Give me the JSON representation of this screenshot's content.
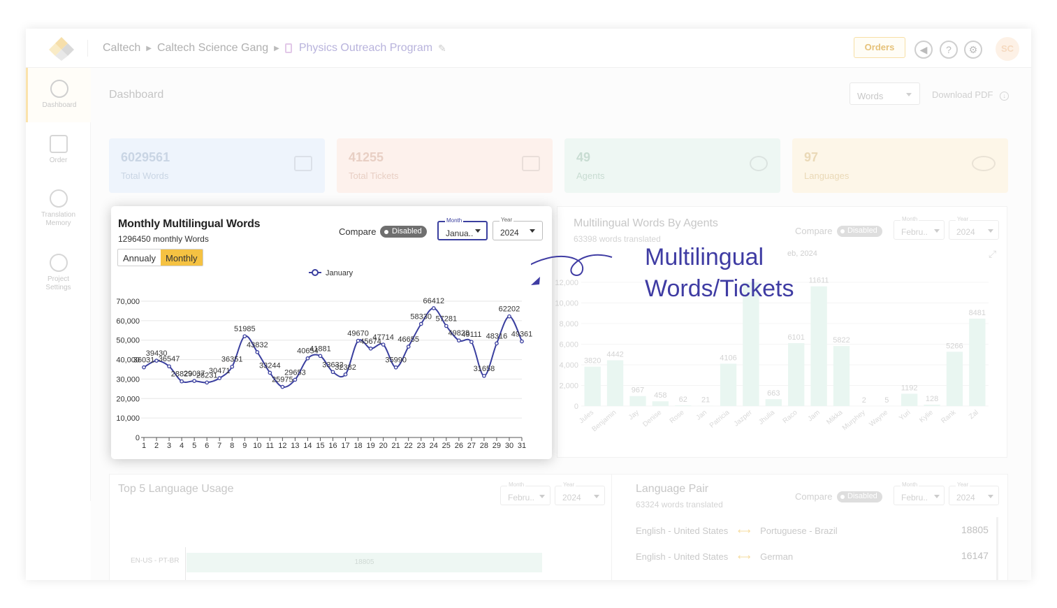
{
  "breadcrumb": [
    "Caltech",
    "Caltech Science Gang",
    "Physics Outreach Program"
  ],
  "header": {
    "orders_label": "Orders",
    "avatar_initials": "SC"
  },
  "sidebar": {
    "items": [
      {
        "label": "Dashboard",
        "active": true
      },
      {
        "label": "Order",
        "active": false
      },
      {
        "label": "Translation Memory",
        "active": false
      },
      {
        "label": "Project Settings",
        "active": false
      }
    ]
  },
  "dashboard": {
    "title": "Dashboard",
    "metric_select": "Words",
    "download_label": "Download PDF"
  },
  "stats": [
    {
      "value": "6029561",
      "label": "Total Words",
      "color": "#eef4fc",
      "text": "#c9d5e4"
    },
    {
      "value": "41255",
      "label": "Total Tickets",
      "color": "#fdf1ec",
      "text": "#e8cfc4"
    },
    {
      "value": "49",
      "label": "Agents",
      "color": "#eef7f3",
      "text": "#c8dcd2"
    },
    {
      "value": "97",
      "label": "Languages",
      "color": "#fdf6e8",
      "text": "#ead9b7"
    }
  ],
  "monthly_card": {
    "title": "Monthly Multilingual Words",
    "subtitle": "1296450 monthly Words",
    "segment": [
      "Annualy",
      "Monthly"
    ],
    "compare_label": "Compare",
    "toggle_label": "Disabled",
    "month_label": "Month",
    "month_value": "Janua..",
    "year_label": "Year",
    "year_value": "2024",
    "legend": "January",
    "line_color": "#3a3f9f"
  },
  "agents_panel": {
    "title": "Multilingual Words By Agents",
    "subtitle": "63398 words translated",
    "compare_label": "Compare",
    "toggle_label": "Disabled",
    "month_label": "Month",
    "month_value": "Febru..",
    "year_label": "Year",
    "year_value": "2024",
    "period_fragment": "eb, 2024"
  },
  "top5_panel": {
    "title": "Top 5 Language Usage",
    "month_label": "Month",
    "month_value": "Febru..",
    "year_label": "Year",
    "year_value": "2024",
    "row_label": "EN-US - PT-BR",
    "row_value": "18805"
  },
  "pair_panel": {
    "title": "Language Pair",
    "subtitle": "63324 words translated",
    "compare_label": "Compare",
    "toggle_label": "Disabled",
    "month_label": "Month",
    "month_value": "Febru..",
    "year_label": "Year",
    "year_value": "2024",
    "rows": [
      {
        "from": "English - United States",
        "to": "Portuguese - Brazil",
        "value": "18805"
      },
      {
        "from": "English - United States",
        "to": "German",
        "value": "16147"
      }
    ]
  },
  "annotation": {
    "line1": "Multilingual",
    "line2": "Words/Tickets"
  },
  "chart_data": [
    {
      "type": "line",
      "title": "Monthly Multilingual Words",
      "series": [
        {
          "name": "January",
          "values": [
            36031,
            39430,
            36547,
            28829,
            29037,
            28231,
            30471,
            36351,
            51985,
            43832,
            33244,
            25975,
            29653,
            40654,
            41881,
            33632,
            32382,
            49670,
            45674,
            47714,
            35990,
            46655,
            58330,
            66412,
            57281,
            49828,
            49111,
            31658,
            48316,
            62202,
            49361
          ]
        }
      ],
      "x": [
        1,
        2,
        3,
        4,
        5,
        6,
        7,
        8,
        9,
        10,
        11,
        12,
        13,
        14,
        15,
        16,
        17,
        18,
        19,
        20,
        21,
        22,
        23,
        24,
        25,
        26,
        27,
        28,
        29,
        30,
        31
      ],
      "point_labels": [
        "36031",
        "39430",
        "36547",
        "28829",
        "29037",
        "28231",
        "30471",
        "36351",
        "51985",
        "43832",
        "33244",
        "25975",
        "29653",
        "40654",
        "41881",
        "33632",
        "32382",
        "49670",
        "45674",
        "47714",
        "35990",
        "46655",
        "58330",
        "66412",
        "57281",
        "49828",
        "49111",
        "31658",
        "48316",
        "62202",
        "49361"
      ],
      "yticks": [
        "0",
        "10,000",
        "20,000",
        "30,000",
        "40,000",
        "50,000",
        "60,000",
        "70,000"
      ],
      "ylim": [
        0,
        70000
      ],
      "grid": true,
      "legend": "top-center"
    },
    {
      "type": "bar",
      "title": "Multilingual Words By Agents",
      "categories": [
        "Jules",
        "Benjamin",
        "Jay",
        "Denise",
        "Rose",
        "Jan",
        "Patricia",
        "Jazper",
        "Jhulia",
        "Raco",
        "Jam",
        "Mikka",
        "Murphey",
        "Wayne",
        "Yuri",
        "Kylie",
        "Rank",
        "Zal"
      ],
      "values": [
        3820,
        4442,
        967,
        458,
        62,
        21,
        4106,
        12000,
        663,
        6101,
        11611,
        5822,
        2,
        5,
        1192,
        128,
        5266,
        8481
      ],
      "value_labels": [
        "3820",
        "4442",
        "967",
        "458",
        "62",
        "21",
        "4106",
        "",
        "663",
        "6101",
        "11611",
        "5822",
        "2",
        "5",
        "1192",
        "128",
        "5266",
        "8481"
      ],
      "yticks": [
        "0",
        "2,000",
        "4,000",
        "6,000",
        "8,000",
        "10,000",
        "12,000"
      ],
      "ylim": [
        0,
        12000
      ],
      "color": "#e9f6f1"
    }
  ]
}
